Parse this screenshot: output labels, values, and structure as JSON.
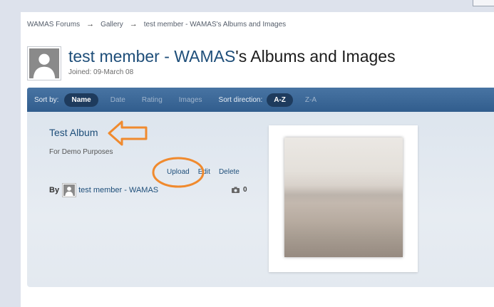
{
  "breadcrumb": {
    "items": [
      "WAMAS Forums",
      "Gallery",
      "test member - WAMAS's Albums and Images"
    ],
    "separator": "→"
  },
  "header": {
    "title_link": "test member - WAMAS",
    "title_suffix": "'s Albums and Images",
    "joined": "Joined: 09-March 08"
  },
  "sortbar": {
    "sort_by_label": "Sort by:",
    "sort_options": [
      "Name",
      "Date",
      "Rating",
      "Images"
    ],
    "active_sort": "Name",
    "direction_label": "Sort direction:",
    "direction_options": [
      "A-Z",
      "Z-A"
    ],
    "active_direction": "A-Z"
  },
  "album": {
    "title": "Test Album",
    "description": "For Demo Purposes",
    "actions": [
      "Upload",
      "Edit",
      "Delete"
    ],
    "by_label": "By",
    "owner": "test member - WAMAS",
    "image_count": "0"
  },
  "icons": {
    "profile": "user-silhouette-icon",
    "camera": "camera-icon",
    "annotation_arrow": "left-arrow-outline-icon"
  },
  "colors": {
    "accent": "#1e4e79",
    "sortbar": "#3a6696",
    "annotation": "#f08a2e"
  }
}
